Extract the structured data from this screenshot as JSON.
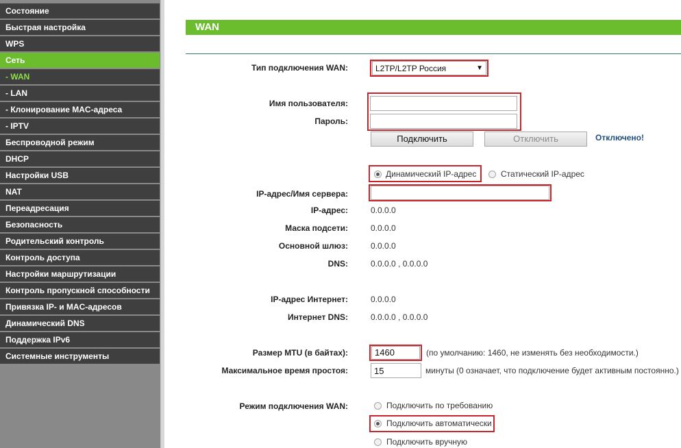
{
  "sidebar": {
    "items": [
      {
        "label": "Состояние",
        "state": "normal"
      },
      {
        "label": "Быстрая настройка",
        "state": "normal"
      },
      {
        "label": "WPS",
        "state": "normal"
      },
      {
        "label": "Сеть",
        "state": "active"
      },
      {
        "label": "- WAN",
        "state": "current"
      },
      {
        "label": "- LAN",
        "state": "normal"
      },
      {
        "label": "- Клонирование MAC-адреса",
        "state": "normal"
      },
      {
        "label": "- IPTV",
        "state": "normal"
      },
      {
        "label": "Беспроводной режим",
        "state": "normal"
      },
      {
        "label": "DHCP",
        "state": "normal"
      },
      {
        "label": "Настройки USB",
        "state": "normal"
      },
      {
        "label": "NAT",
        "state": "normal"
      },
      {
        "label": "Переадресация",
        "state": "normal"
      },
      {
        "label": "Безопасность",
        "state": "normal"
      },
      {
        "label": "Родительский контроль",
        "state": "normal"
      },
      {
        "label": "Контроль доступа",
        "state": "normal"
      },
      {
        "label": "Настройки маршрутизации",
        "state": "normal"
      },
      {
        "label": "Контроль пропускной способности",
        "state": "normal"
      },
      {
        "label": "Привязка IP- и MAC-адресов",
        "state": "normal"
      },
      {
        "label": "Динамический DNS",
        "state": "normal"
      },
      {
        "label": "Поддержка IPv6",
        "state": "normal"
      },
      {
        "label": "Системные инструменты",
        "state": "normal"
      }
    ]
  },
  "page": {
    "title": "WAN"
  },
  "form": {
    "wan_type_label": "Тип подключения WAN:",
    "wan_type_value": "L2TP/L2TP Россия",
    "username_label": "Имя пользователя:",
    "username_value": "",
    "password_label": "Пароль:",
    "password_value": "",
    "connect_button": "Подключить",
    "disconnect_button": "Отключить",
    "status_text": "Отключено!",
    "dynamic_ip_label": "Динамический IP-адрес",
    "dynamic_ip_checked": true,
    "static_ip_label": "Статический IP-адрес",
    "static_ip_checked": false,
    "server_label": "IP-адрес/Имя сервера:",
    "server_value": "",
    "ip_label": "IP-адрес:",
    "ip_value": "0.0.0.0",
    "mask_label": "Маска подсети:",
    "mask_value": "0.0.0.0",
    "gateway_label": "Основной шлюз:",
    "gateway_value": "0.0.0.0",
    "dns_label": "DNS:",
    "dns_value": "0.0.0.0 , 0.0.0.0",
    "inet_ip_label": "IP-адрес Интернет:",
    "inet_ip_value": "0.0.0.0",
    "inet_dns_label": "Интернет DNS:",
    "inet_dns_value": "0.0.0.0 , 0.0.0.0",
    "mtu_label": "Размер MTU (в байтах):",
    "mtu_value": "1460",
    "mtu_hint": "(по умолчанию: 1460, не изменять без необходимости.)",
    "idle_label": "Максимальное время простоя:",
    "idle_value": "15",
    "idle_hint": "минуты (0 означает, что подключение будет активным постоянно.)",
    "mode_label": "Режим подключения WAN:",
    "mode_options": [
      {
        "label": "Подключить по требованию",
        "checked": false
      },
      {
        "label": "Подключить автоматически",
        "checked": true
      },
      {
        "label": "Подключить вручную",
        "checked": false
      }
    ]
  },
  "colors": {
    "accent_green": "#6cbd2e",
    "sidebar_item_bg": "#3f3f3f",
    "sidebar_bg": "#898989",
    "highlight_red": "#c8242a",
    "status_blue": "#1f4f7f"
  }
}
